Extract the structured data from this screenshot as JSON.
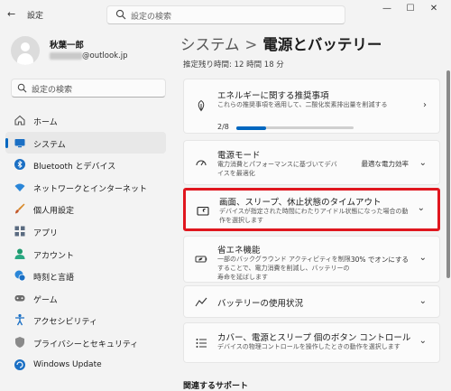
{
  "app": {
    "title": "設定",
    "back_glyph": "←"
  },
  "top_search": {
    "placeholder": "設定の検索"
  },
  "window_controls": {
    "minimize": "—",
    "maximize": "☐",
    "close": "✕"
  },
  "profile": {
    "name": "秋葉一郎",
    "email_suffix": "@outlook.jp"
  },
  "side_search": {
    "placeholder": "設定の検索"
  },
  "sidebar": {
    "items": [
      {
        "label": "ホーム",
        "icon": "home-icon",
        "selected": false
      },
      {
        "label": "システム",
        "icon": "system-icon",
        "selected": true
      },
      {
        "label": "Bluetooth とデバイス",
        "icon": "bluetooth-icon",
        "selected": false
      },
      {
        "label": "ネットワークとインターネット",
        "icon": "wifi-icon",
        "selected": false
      },
      {
        "label": "個人用設定",
        "icon": "brush-icon",
        "selected": false
      },
      {
        "label": "アプリ",
        "icon": "apps-icon",
        "selected": false
      },
      {
        "label": "アカウント",
        "icon": "account-icon",
        "selected": false
      },
      {
        "label": "時刻と言語",
        "icon": "time-language-icon",
        "selected": false
      },
      {
        "label": "ゲーム",
        "icon": "gamepad-icon",
        "selected": false
      },
      {
        "label": "アクセシビリティ",
        "icon": "accessibility-icon",
        "selected": false
      },
      {
        "label": "プライバシーとセキュリティ",
        "icon": "shield-icon",
        "selected": false
      },
      {
        "label": "Windows Update",
        "icon": "update-icon",
        "selected": false
      }
    ]
  },
  "breadcrumb": {
    "parent": "システム",
    "separator": ">",
    "current": "電源とバッテリー"
  },
  "remaining": "推定残り時間: 12 時間 18 分",
  "cards": {
    "energy": {
      "title": "エネルギーに関する推奨事項",
      "desc": "これらの推奨事項を適用して、二酸化炭素排出量を削減する",
      "progress_label": "2/8",
      "progress_fraction": 0.25
    },
    "power_mode": {
      "title": "電源モード",
      "desc": "電力消費とパフォーマンスに基づいてデバイスを最適化",
      "value": "最適な電力効率"
    },
    "sleep": {
      "title": "画面、スリープ、休止状態のタイムアウト",
      "desc": "デバイスが指定された時間にわたりアイドル状態になった場合の動作を選択します"
    },
    "saver": {
      "title": "省エネ機能",
      "desc": "一部のバックグラウンド アクティビティを制限することで、電力消費を削減し、バッテリーの寿命を延ばします",
      "value": "30% でオンにする"
    },
    "battery_usage": {
      "title": "バッテリーの使用状況"
    },
    "lid": {
      "title": "カバー、電源とスリープ 個のボタン コントロール",
      "desc": "デバイスの物理コントロールを操作したときの動作を選択します"
    }
  },
  "related_support": "関連するサポート",
  "colors": {
    "accent": "#0067c0",
    "highlight": "#e0161e"
  }
}
